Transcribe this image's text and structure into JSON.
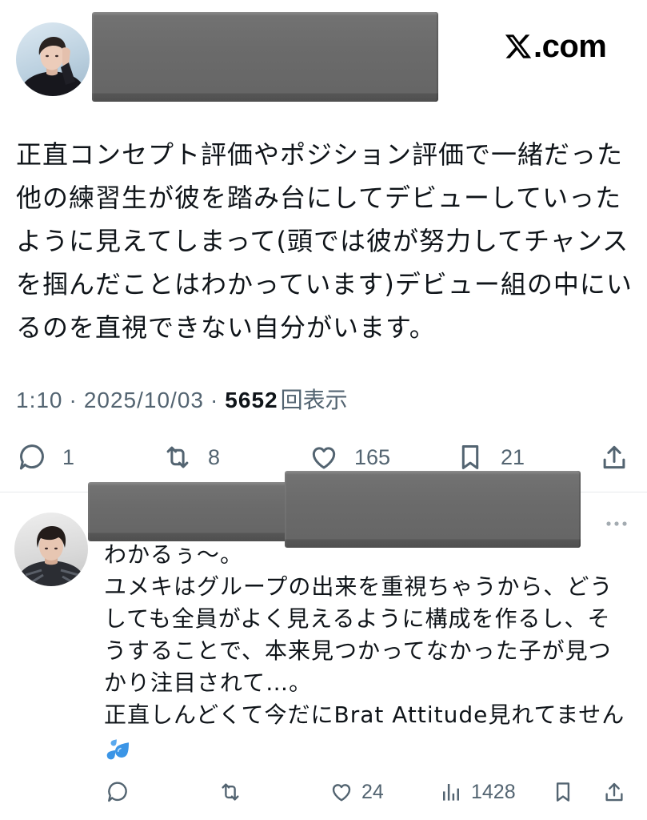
{
  "header": {
    "logo_icon": "x-logo-icon",
    "domain_suffix": ".com"
  },
  "post": {
    "body_lines": [
      "正直コンセプト評価やポジション評価で一緒だった",
      "他の練習生が彼を踏み台にしてデビューしていった",
      "ように見えてしまって(頭では彼が努力してチャンス",
      "を掴んだことはわかっています)デビュー組の中にい",
      "るのを直視できない自分がいます。"
    ],
    "meta": {
      "time": "1:10",
      "separator": "·",
      "date": "2025/10/03",
      "views": "5652",
      "views_label": "回表示"
    },
    "action_icons": [
      "reply-icon",
      "repost-icon",
      "like-icon",
      "bookmark-icon",
      "share-icon"
    ],
    "actions": {
      "reply_count": "1",
      "repost_count": "8",
      "like_count": "165",
      "bookmark_count": "21"
    }
  },
  "reply": {
    "more_icon": "more-icon",
    "body_lines": [
      "わかるぅ〜。",
      "ユメキはグループの出来を重視ちゃうから、どう",
      "しても全員がよく見えるように構成を作るし、そ",
      "うすることで、本来見つかってなかった子が見つ",
      "かり注目されて…。",
      "正直しんどくて今だにBrat Attitude見れてません"
    ],
    "emoji_icon": "sweat-droplets-icon",
    "action_icons": [
      "reply-icon",
      "repost-icon",
      "like-icon",
      "views-icon",
      "bookmark-icon",
      "share-icon"
    ],
    "actions": {
      "like_count": "24",
      "view_count": "1428"
    }
  },
  "colors": {
    "background": "#ffffff",
    "text_primary": "#0f1419",
    "text_secondary": "#536471",
    "divider": "#e7ebed",
    "redaction": "#6b6b6b",
    "emoji_blue": "#3b95e6"
  }
}
